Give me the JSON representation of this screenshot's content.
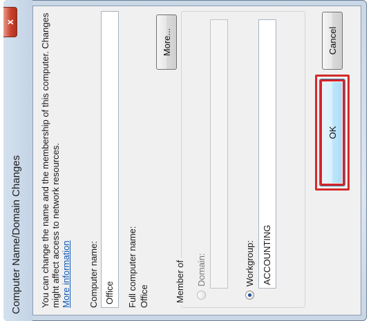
{
  "window": {
    "title": "Computer Name/Domain Changes",
    "close_label": "x"
  },
  "intro": {
    "text": "You can change the name and the membership of this computer. Changes might affect access to network resources.",
    "link": "More information"
  },
  "computer_name": {
    "label": "Computer name:",
    "value": "Office"
  },
  "full_name": {
    "label": "Full computer name:",
    "value": "Office"
  },
  "more_button": "More...",
  "member_of": {
    "label": "Member of",
    "domain_label": "Domain:",
    "domain_value": "",
    "workgroup_label": "Workgroup:",
    "workgroup_value": "ACCOUNTING",
    "selected": "workgroup"
  },
  "buttons": {
    "ok": "OK",
    "cancel": "Cancel"
  },
  "colors": {
    "highlight": "#d32a2a",
    "link": "#0b57b8"
  }
}
